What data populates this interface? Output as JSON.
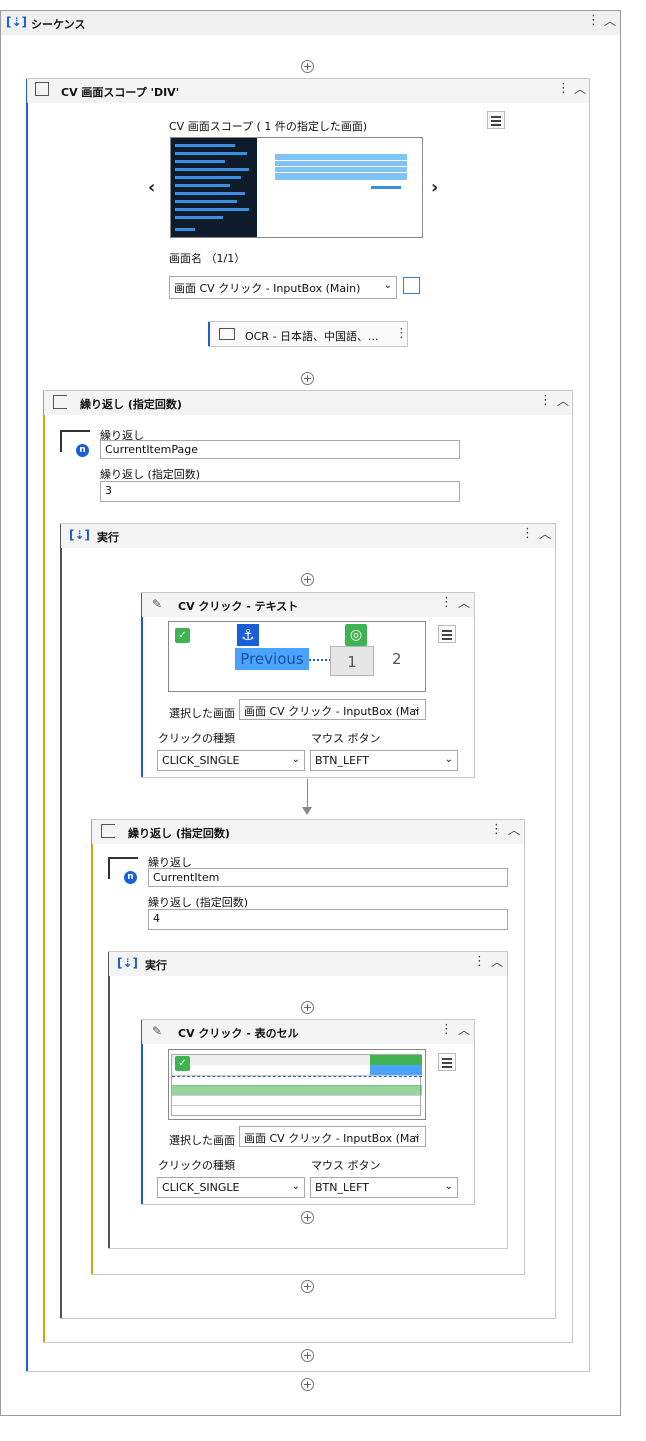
{
  "sequence": {
    "title": "シーケンス"
  },
  "scope": {
    "title": "CV 画面スコープ 'DIV'",
    "count_label": "CV 画面スコープ ( 1 件の指定した画面)",
    "screen_name_label": "画面名 （1/1）",
    "screen_select": "画面 CV クリック - InputBox (Main)",
    "ocr_label": "OCR - 日本語、中国語、...",
    "prev_icon": "chevron-left-icon",
    "next_icon": "chevron-right-icon"
  },
  "outer_loop": {
    "title": "繰り返し (指定回数)",
    "var_label": "繰り返し",
    "var_value": "CurrentItemPage",
    "count_label": "繰り返し (指定回数)",
    "count_value": "3",
    "badge": "n"
  },
  "outer_do": {
    "title": "実行"
  },
  "click_text": {
    "title": "CV クリック - テキスト",
    "preview_target": "Previous",
    "preview_page1": "1",
    "preview_page2": "2",
    "screen_label": "選択した画面",
    "screen_value": "画面 CV クリック - InputBox (Mai",
    "click_type_label": "クリックの種類",
    "click_type_value": "CLICK_SINGLE",
    "mouse_label": "マウス ボタン",
    "mouse_value": "BTN_LEFT"
  },
  "inner_loop": {
    "title": "繰り返し (指定回数)",
    "var_label": "繰り返し",
    "var_value": "CurrentItem",
    "count_label": "繰り返し (指定回数)",
    "count_value": "4",
    "badge": "n"
  },
  "inner_do": {
    "title": "実行"
  },
  "click_cell": {
    "title": "CV クリック - 表のセル",
    "screen_label": "選択した画面",
    "screen_value": "画面 CV クリック - InputBox (Mai",
    "click_type_label": "クリックの種類",
    "click_type_value": "CLICK_SINGLE",
    "mouse_label": "マウス ボタン",
    "mouse_value": "BTN_LEFT"
  },
  "colors": {
    "accent_blue": "#1a5fd8",
    "loop_orange": "#d4a017",
    "do_gray": "#555555",
    "highlight": "#4aa3ff",
    "anchor_green": "#3fb34f"
  }
}
